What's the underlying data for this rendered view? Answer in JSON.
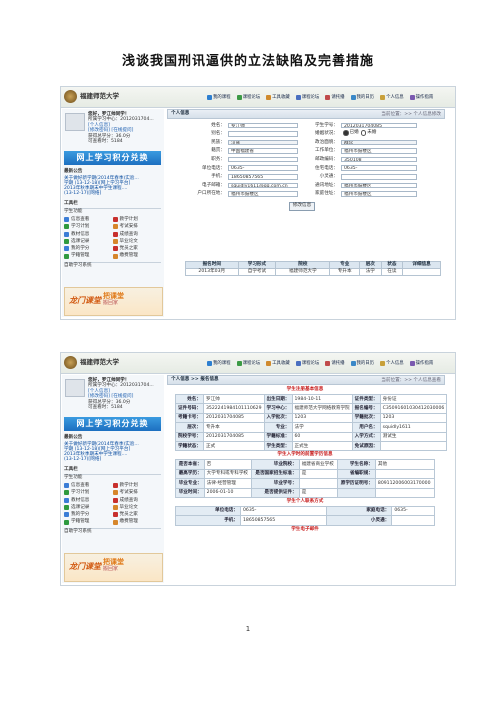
{
  "document": {
    "title": "浅谈我国刑讯逼供的立法缺陷及完善措施",
    "page_number": "1"
  },
  "app": {
    "logo_text": "福建师范大学",
    "nav": [
      {
        "label": "我的课程",
        "color": "#2d7fd0"
      },
      {
        "label": "课程论坛",
        "color": "#3c9a45"
      },
      {
        "label": "工具收藏",
        "color": "#d08a2d"
      },
      {
        "label": "课程论坛",
        "color": "#4a6fc0"
      },
      {
        "label": "请托播",
        "color": "#c04a4a"
      },
      {
        "label": "我的日历",
        "color": "#3a88c8"
      },
      {
        "label": "个人信息",
        "color": "#c8a03a"
      },
      {
        "label": "操作指南",
        "color": "#7a5ab0"
      }
    ],
    "user": {
      "greeting": "您好，罗江帅同学！",
      "id_line": "所属学习中心：2012031704...",
      "status": "[个人信息]",
      "links": "[修改密码]  [在线提问]",
      "credits": "获得总学分：36.0分",
      "hours": "可查看时：5184"
    },
    "banner": "网上学习积分兑换",
    "notice": {
      "title": "最新公告",
      "items": [
        "关于做好新学期(2014年春季)实验...",
        "学期 (13-12-18)[网上学习平台]",
        "2013年秋季期末中学生课程....",
        "(13-12-17)[网络]"
      ]
    },
    "tools": {
      "title": "工具栏",
      "subtitle": "学生功能",
      "items": [
        {
          "label": "信息查看",
          "color": "#3b7dd6"
        },
        {
          "label": "教学计划",
          "color": "#c8302d"
        },
        {
          "label": "学习计划",
          "color": "#2f9a3f"
        },
        {
          "label": "考试安排",
          "color": "#d6862b"
        },
        {
          "label": "教材信息",
          "color": "#3b7dd6"
        },
        {
          "label": "成绩查询",
          "color": "#c8302d"
        },
        {
          "label": "选课记录",
          "color": "#2f9a3f"
        },
        {
          "label": "毕业论文",
          "color": "#d6862b"
        },
        {
          "label": "我的学分",
          "color": "#3b7dd6"
        },
        {
          "label": "党员之家",
          "color": "#c8302d"
        },
        {
          "label": "学籍管理",
          "color": "#2f9a3f"
        },
        {
          "label": "缴费管理",
          "color": "#d6862b"
        }
      ],
      "footer": "自助学习系统"
    },
    "ad": {
      "text1": "龙门课堂",
      "text2": "把课堂",
      "text3": "搬回家"
    }
  },
  "screen1": {
    "tab_title": "个人信息",
    "tab_right": "当前位置：>> 个人信息修改",
    "form_rows": [
      {
        "l1": "姓名：",
        "v1": "罗江帅",
        "l2": "学生学号：",
        "v2": "2012031704085"
      },
      {
        "l1": "别名：",
        "v1": "",
        "l2": "婚姻状况：",
        "v2": "radio"
      },
      {
        "l1": "民族：",
        "v1": "汉族",
        "l2": "政治面貌：",
        "v2": "群众"
      },
      {
        "l1": "籍贯：",
        "v1": "中国福建省",
        "l2": "工作单位：",
        "v2": "福州市鼓楼区"
      },
      {
        "l1": "职务：",
        "v1": "",
        "l2": "邮政编码：",
        "v2": "350108"
      },
      {
        "l1": "单位电话：",
        "v1": "0635-",
        "l2": "住宅电话：",
        "v2": "0635-"
      },
      {
        "l1": "手机：",
        "v1": "18650857565",
        "l2": "小灵通：",
        "v2": ""
      },
      {
        "l1": "电子邮箱：",
        "v1": "squidly1611@qq.com.cn",
        "l2": "通讯地址：",
        "v2": "福州市鼓楼区"
      },
      {
        "l1": "户口所在地：",
        "v1": "福州市鼓楼区",
        "l2": "家庭住址：",
        "v2": "福州市鼓楼区"
      }
    ],
    "marital_options": [
      "已婚",
      "未婚"
    ],
    "save_label": "修改信息",
    "table_headers": [
      "报名时间",
      "学习形式",
      "院校",
      "专业",
      "层次",
      "状态",
      "详细信息"
    ],
    "table_rows": [
      [
        "2013年03月",
        "自学考试",
        "福建师范大学",
        "专升本",
        "法学",
        "在读"
      ]
    ]
  },
  "screen2": {
    "tab_title": "个人信息 >> 报名信息",
    "tab_right": "当前位置：>> 个人信息查看",
    "section1": "学生注册基本信息",
    "rows1": [
      [
        "姓名：",
        "罗江帅",
        "出生日期：",
        "1984-10-11",
        "证件类型：",
        "身份证"
      ],
      [
        "证件号码：",
        "3522241984101110629",
        "学习中心：",
        "福建师范大学网络教育学院",
        "报名编号：",
        "C35091601030412030006"
      ],
      [
        "考籍卡号：",
        "2012031704085",
        "入学批次：",
        "1203",
        "学籍批次：",
        "1203"
      ],
      [
        "层次：",
        "专升本",
        "专业：",
        "法学",
        "用户名：",
        "squidly1611"
      ],
      [
        "院校学号：",
        "2012031704085",
        "学籍标准：",
        "60",
        "入学方式：",
        "测试生"
      ],
      [
        "学籍状态：",
        "正式",
        "学生类型：",
        "正式生",
        "免试原因：",
        ""
      ]
    ],
    "section2": "学生入学时的前置学历信息",
    "rows2": [
      [
        "是否本省：",
        "否",
        "毕业院校：",
        "福建省商业学校",
        "学生名称：",
        "其他"
      ],
      [
        "最高学历：",
        "大学专科或专科学校",
        "是否国家招生标准：",
        "是",
        "省编职规：",
        ""
      ],
      [
        "毕业专业：",
        "法律-经营管理",
        "毕业学号：",
        "",
        "原学历证明号：",
        "809112006003170000"
      ],
      [
        "毕业时间：",
        "2006-01-10",
        "是否提供证件：",
        "是",
        "",
        ""
      ]
    ],
    "section3": "学生个人联系方式",
    "rows3": [
      [
        "单位电话：",
        "0635-",
        "家庭电话：",
        "0635-"
      ],
      [
        "手机：",
        "18650857565",
        "小灵通：",
        ""
      ]
    ],
    "section4": "学生电子邮件"
  }
}
